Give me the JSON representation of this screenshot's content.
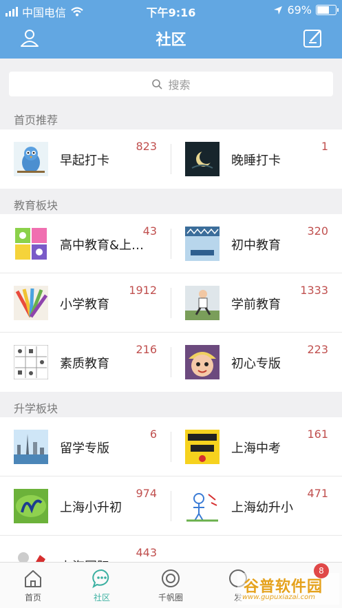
{
  "status_bar": {
    "carrier": "中国电信",
    "time": "下午9:16",
    "battery_text": "69%",
    "battery_level": 0.69
  },
  "nav": {
    "title": "社区",
    "left_icon": "user-icon",
    "right_icon": "compose-icon"
  },
  "search": {
    "placeholder": "搜索"
  },
  "sections": [
    {
      "label": "首页推荐",
      "rows": [
        [
          {
            "name": "早起打卡",
            "count": "823",
            "thumb": "bird"
          },
          {
            "name": "晚睡打卡",
            "count": "1",
            "thumb": "moon"
          }
        ]
      ]
    },
    {
      "label": "教育板块",
      "rows": [
        [
          {
            "name": "高中教育&上…",
            "count": "43",
            "thumb": "flowers"
          },
          {
            "name": "初中教育",
            "count": "320",
            "thumb": "blue-poster"
          }
        ],
        [
          {
            "name": "小学教育",
            "count": "1912",
            "thumb": "pencils"
          },
          {
            "name": "学前教育",
            "count": "1333",
            "thumb": "kid-jump"
          }
        ],
        [
          {
            "name": "素质教育",
            "count": "216",
            "thumb": "chart-grid"
          },
          {
            "name": "初心专版",
            "count": "223",
            "thumb": "cartoon-face"
          }
        ]
      ]
    },
    {
      "label": "升学板块",
      "rows": [
        [
          {
            "name": "留学专版",
            "count": "6",
            "thumb": "city-skyline"
          },
          {
            "name": "上海中考",
            "count": "161",
            "thumb": "yellow-poster"
          }
        ],
        [
          {
            "name": "上海小升初",
            "count": "974",
            "thumb": "green-logo"
          },
          {
            "name": "上海幼升小",
            "count": "471",
            "thumb": "kid-drawing"
          }
        ],
        [
          {
            "name": "上海国际",
            "count": "443",
            "thumb": "red-logo"
          }
        ]
      ]
    }
  ],
  "tabbar": {
    "items": [
      {
        "label": "首页",
        "icon": "home-icon"
      },
      {
        "label": "社区",
        "icon": "chat-icon",
        "active": true
      },
      {
        "label": "千帆圈",
        "icon": "circle-icon"
      },
      {
        "label": "发",
        "icon": "compass-icon"
      }
    ],
    "badge": "8"
  },
  "watermark": {
    "text": "谷普软件园",
    "url": "www.gupuxiazai.com"
  },
  "colors": {
    "header": "#62a7e2",
    "count": "#c0504f",
    "active_tab": "#3bb0a1"
  }
}
